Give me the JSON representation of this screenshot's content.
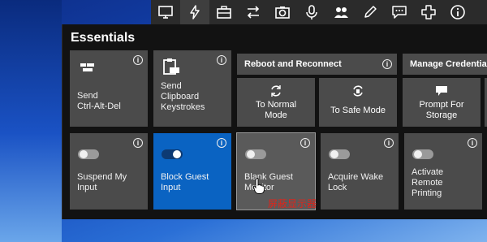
{
  "toolbar": {
    "icons": [
      "desktop-icon",
      "lightning-icon",
      "briefcase-icon",
      "arrows-icon",
      "camera-icon",
      "microphone-icon",
      "users-icon",
      "pencil-icon",
      "chat-icon",
      "plus-icon",
      "info-icon"
    ],
    "active_index": 1
  },
  "panel": {
    "title": "Essentials",
    "tiles": {
      "send_cad": "Send\nCtrl-Alt-Del",
      "send_clipboard": "Send\nClipboard\nKeystrokes",
      "suspend_input": "Suspend My\nInput",
      "block_guest": "Block Guest\nInput",
      "blank_monitor": "Blank Guest\nMonitor",
      "acquire_wake": "Acquire Wake\nLock",
      "activate_printing": "Activate\nRemote\nPrinting"
    },
    "sections": {
      "reboot": {
        "title": "Reboot and Reconnect",
        "normal": "To Normal\nMode",
        "safe": "To Safe Mode"
      },
      "credentials": {
        "title": "Manage Credentia",
        "prompt": "Prompt For\nStorage"
      }
    },
    "toggles": {
      "suspend_input": false,
      "block_guest": true,
      "blank_monitor": false,
      "acquire_wake": false,
      "activate_printing": false
    }
  },
  "caption": "屏蔽显示器",
  "colors": {
    "accent": "#0a63c2",
    "tile": "#4b4b4b",
    "panel": "#121212",
    "caption": "#e0241b"
  }
}
